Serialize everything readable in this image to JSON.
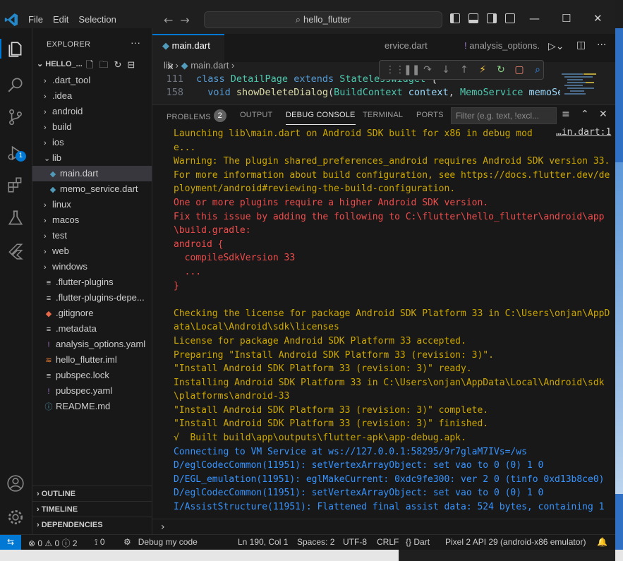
{
  "menu": [
    "File",
    "Edit",
    "Selection"
  ],
  "search": {
    "text": "hello_flutter"
  },
  "explorer": {
    "title": "EXPLORER",
    "root": "HELLO_...",
    "items": [
      {
        "label": ".dart_tool",
        "type": "folder"
      },
      {
        "label": ".idea",
        "type": "folder"
      },
      {
        "label": "android",
        "type": "folder"
      },
      {
        "label": "build",
        "type": "folder"
      },
      {
        "label": "ios",
        "type": "folder"
      },
      {
        "label": "lib",
        "type": "folder-open"
      },
      {
        "label": "main.dart",
        "type": "dart"
      },
      {
        "label": "memo_service.dart",
        "type": "dart"
      },
      {
        "label": "linux",
        "type": "folder"
      },
      {
        "label": "macos",
        "type": "folder"
      },
      {
        "label": "test",
        "type": "folder"
      },
      {
        "label": "web",
        "type": "folder"
      },
      {
        "label": "windows",
        "type": "folder"
      },
      {
        "label": ".flutter-plugins",
        "type": "file"
      },
      {
        "label": ".flutter-plugins-depe...",
        "type": "file"
      },
      {
        "label": ".gitignore",
        "type": "git"
      },
      {
        "label": ".metadata",
        "type": "file"
      },
      {
        "label": "analysis_options.yaml",
        "type": "yaml"
      },
      {
        "label": "hello_flutter.iml",
        "type": "iml"
      },
      {
        "label": "pubspec.lock",
        "type": "file"
      },
      {
        "label": "pubspec.yaml",
        "type": "yaml"
      },
      {
        "label": "README.md",
        "type": "info"
      }
    ],
    "sections": [
      "OUTLINE",
      "TIMELINE",
      "DEPENDENCIES"
    ]
  },
  "activity": {
    "debug_badge": "1"
  },
  "tabs": {
    "main": "main.dart",
    "memo": "ervice.dart",
    "analysis": "analysis_options."
  },
  "breadcrumb": {
    "folder": "lib",
    "file": "main.dart"
  },
  "code": [
    {
      "ln": "111",
      "text": "class DetailPage extends StatelessWidget {"
    },
    {
      "ln": "158",
      "text": "  void showDeleteDialog(BuildContext context, MemoService memoServ"
    }
  ],
  "panel": {
    "tabs": [
      "PROBLEMS",
      "OUTPUT",
      "DEBUG CONSOLE",
      "TERMINAL",
      "PORTS"
    ],
    "problems_count": "2",
    "filter_placeholder": "Filter (e.g. text, !excl...",
    "source_link": "…in.dart:1",
    "lines": [
      {
        "t": "Launching lib\\main.dart on Android SDK built for x86 in debug mod",
        "c": "warn"
      },
      {
        "t": "e...",
        "c": "warn"
      },
      {
        "t": "Warning: The plugin shared_preferences_android requires Android SDK version 33.",
        "c": "warn"
      },
      {
        "t": "For more information about build configuration, see https://docs.flutter.dev/de",
        "c": "warn"
      },
      {
        "t": "ployment/android#reviewing-the-build-configuration.",
        "c": "warn"
      },
      {
        "t": "One or more plugins require a higher Android SDK version.",
        "c": "err"
      },
      {
        "t": "Fix this issue by adding the following to C:\\flutter\\hello_flutter\\android\\app",
        "c": "err"
      },
      {
        "t": "\\build.gradle:",
        "c": "err"
      },
      {
        "t": "android {",
        "c": "err"
      },
      {
        "t": "  compileSdkVersion 33",
        "c": "err"
      },
      {
        "t": "  ...",
        "c": "err"
      },
      {
        "t": "}",
        "c": "err"
      },
      {
        "t": "",
        "c": "warn"
      },
      {
        "t": "Checking the license for package Android SDK Platform 33 in C:\\Users\\onjan\\AppD",
        "c": "warn"
      },
      {
        "t": "ata\\Local\\Android\\sdk\\licenses",
        "c": "warn"
      },
      {
        "t": "License for package Android SDK Platform 33 accepted.",
        "c": "warn"
      },
      {
        "t": "Preparing \"Install Android SDK Platform 33 (revision: 3)\".",
        "c": "warn"
      },
      {
        "t": "\"Install Android SDK Platform 33 (revision: 3)\" ready.",
        "c": "warn"
      },
      {
        "t": "Installing Android SDK Platform 33 in C:\\Users\\onjan\\AppData\\Local\\Android\\sdk",
        "c": "warn"
      },
      {
        "t": "\\platforms\\android-33",
        "c": "warn"
      },
      {
        "t": "\"Install Android SDK Platform 33 (revision: 3)\" complete.",
        "c": "warn"
      },
      {
        "t": "\"Install Android SDK Platform 33 (revision: 3)\" finished.",
        "c": "warn"
      },
      {
        "t": "√  Built build\\app\\outputs\\flutter-apk\\app-debug.apk.",
        "c": "warn"
      },
      {
        "t": "Connecting to VM Service at ws://127.0.0.1:58295/9r7glaM7IVs=/ws",
        "c": "info"
      },
      {
        "t": "D/eglCodecCommon(11951): setVertexArrayObject: set vao to 0 (0) 1 0",
        "c": "info"
      },
      {
        "t": "D/EGL_emulation(11951): eglMakeCurrent: 0xdc9fe300: ver 2 0 (tinfo 0xd13b8ce0)",
        "c": "info"
      },
      {
        "t": "D/eglCodecCommon(11951): setVertexArrayObject: set vao to 0 (0) 1 0",
        "c": "info"
      },
      {
        "t": "I/AssistStructure(11951): Flattened final assist data: 524 bytes, containing 1",
        "c": "info"
      }
    ]
  },
  "status": {
    "errors": "0",
    "warnings_a": "0",
    "warnings_b": "2",
    "ports": "0",
    "debug": "Debug my code",
    "position": "Ln 190, Col 1",
    "spaces": "Spaces: 2",
    "encoding": "UTF-8",
    "eol": "CRLF",
    "language": "Dart",
    "device": "Pixel 2 API 29 (android-x86 emulator)"
  },
  "colors": {
    "accent": "#0078d4",
    "warn": "#cca700",
    "error": "#f14c4c",
    "info": "#3794ff"
  }
}
